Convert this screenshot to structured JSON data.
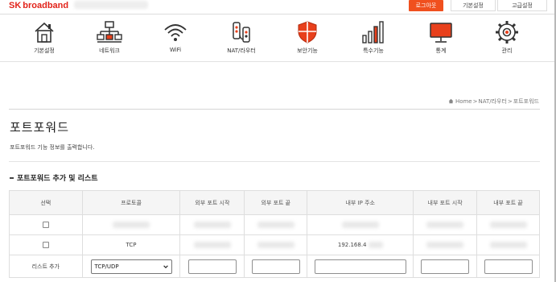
{
  "brand": {
    "sk": "SK",
    "name": "broadband"
  },
  "colors": {
    "brand_red": "#e2231a",
    "logout_orange": "#f0501e",
    "shield_red": "#e8401c"
  },
  "top_buttons": {
    "logout": "로그아웃",
    "basic": "기본설정",
    "advanced": "고급설정"
  },
  "nav": [
    {
      "label": "기본설정",
      "icon": "home-icon"
    },
    {
      "label": "네트워크",
      "icon": "network-icon"
    },
    {
      "label": "WiFi",
      "icon": "wifi-icon"
    },
    {
      "label": "NAT/라우터",
      "icon": "router-icon"
    },
    {
      "label": "보안기능",
      "icon": "shield-icon"
    },
    {
      "label": "특수기능",
      "icon": "bar-chart-icon"
    },
    {
      "label": "통계",
      "icon": "monitor-icon"
    },
    {
      "label": "관리",
      "icon": "gear-icon"
    }
  ],
  "breadcrumb": {
    "home": "Home",
    "section": "NAT/라우터",
    "current": "포트포워드",
    "sep": ">"
  },
  "page": {
    "title": "포트포워드",
    "description": "포트포워드 기능 정보를 출력합니다."
  },
  "section": {
    "title": "포트포워드 추가 및 리스트"
  },
  "table": {
    "headers": [
      "선택",
      "프로토콜",
      "외부 포트 시작",
      "외부 포트 끝",
      "내부 IP 주소",
      "내부 포트 시작",
      "내부 포트 끝"
    ],
    "rows": [
      {
        "protocol": "",
        "ip": ""
      },
      {
        "protocol": "TCP",
        "ip": "192.168.4"
      }
    ],
    "add_row": {
      "label": "리스트 추가",
      "protocol_selected": "TCP/UDP"
    }
  }
}
